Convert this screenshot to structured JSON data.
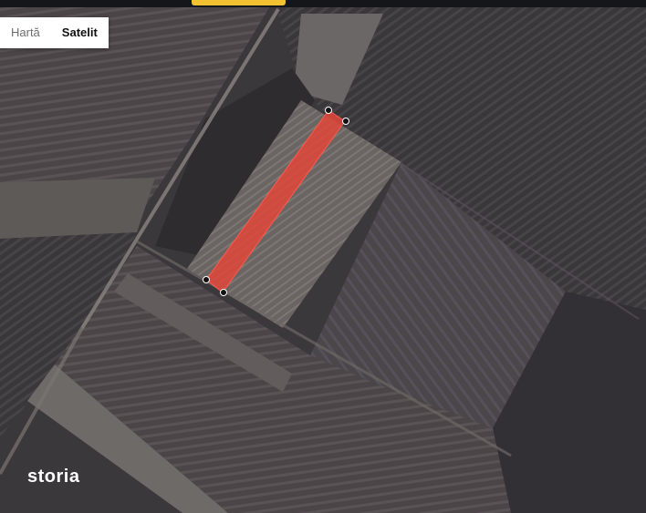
{
  "map_type": {
    "options": [
      "Hartă",
      "Satelit"
    ],
    "selected": "Satelit"
  },
  "branding": {
    "logo": "storia"
  },
  "parcel": {
    "highlight_color": "#e0463b",
    "vertex_markers": 4
  },
  "colors": {
    "accent": "#f2c230",
    "topbar": "#15161a"
  }
}
